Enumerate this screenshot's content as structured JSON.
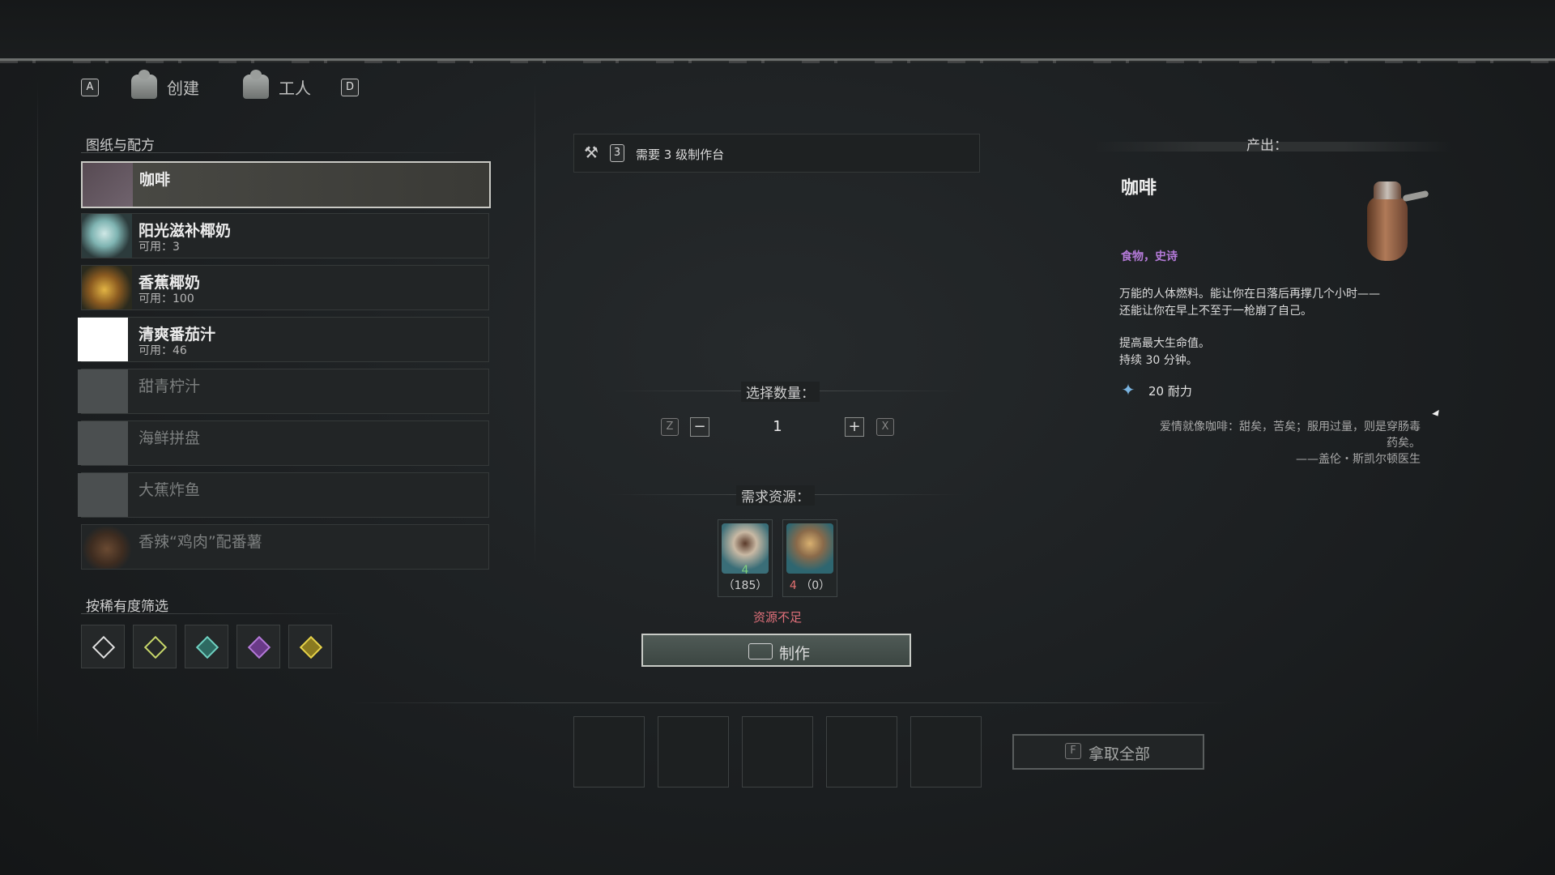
{
  "header": {
    "key_left": "A",
    "tab_create": "创建",
    "tab_workers": "工人",
    "key_right": "D"
  },
  "recipes": {
    "title": "图纸与配方",
    "items": [
      {
        "name": "咖啡",
        "sub": ""
      },
      {
        "name": "阳光滋补椰奶",
        "sub": "可用：3"
      },
      {
        "name": "香蕉椰奶",
        "sub": "可用：100"
      },
      {
        "name": "清爽番茄汁",
        "sub": "可用：46"
      },
      {
        "name": "甜青柠汁",
        "sub": ""
      },
      {
        "name": "海鲜拼盘",
        "sub": ""
      },
      {
        "name": "大蕉炸鱼",
        "sub": ""
      },
      {
        "name": "香辣“鸡肉”配番薯",
        "sub": ""
      }
    ]
  },
  "filter": {
    "title": "按稀有度筛选",
    "colors": [
      "#e0e0e0",
      "#c8d86a",
      "#6fd0c0",
      "#b47ad8",
      "#e6d24a"
    ]
  },
  "requirement": {
    "level": "3",
    "text": "需要 3 级制作台"
  },
  "quantity": {
    "title": "选择数量：",
    "key_minus": "Z",
    "key_plus": "X",
    "value": "1"
  },
  "resources": {
    "title": "需求资源：",
    "items": [
      {
        "need": "4",
        "have": "（185）"
      },
      {
        "need": "4",
        "have": "（0）"
      }
    ],
    "warning": "资源不足"
  },
  "craft": {
    "label": "制作"
  },
  "take_all": {
    "key": "F",
    "label": "拿取全部"
  },
  "output": {
    "title": "产出：",
    "name": "咖啡",
    "tags": "食物，史诗",
    "desc1": "万能的人体燃料。能让你在日落后再撑几个小时——",
    "desc2": "还能让你在早上不至于一枪崩了自己。",
    "effect1": "提高最大生命值。",
    "effect2": "持续 30 分钟。",
    "stamina": "20 耐力",
    "quote1": "爱情就像咖啡：甜矣，苦矣；服用过量，则是穿肠毒",
    "quote2": "药矣。",
    "quote_author": "——盖伦・斯凯尔顿医生"
  }
}
